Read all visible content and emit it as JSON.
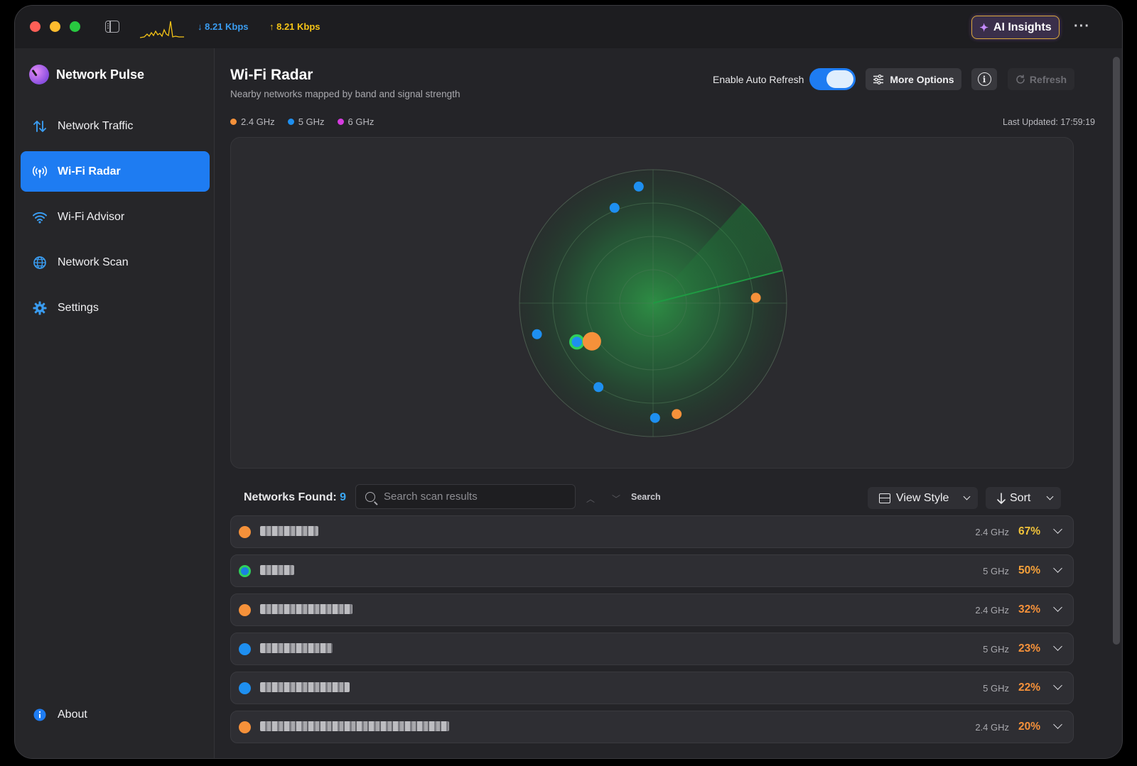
{
  "titlebar": {
    "download_speed": "↓ 8.21 Kbps",
    "upload_speed": "↑ 8.21 Kbps",
    "ai_insights_label": "AI Insights",
    "more_icon": "ellipsis-icon"
  },
  "sidebar": {
    "app_name": "Network Pulse",
    "items": [
      {
        "label": "Network Traffic",
        "icon": "arrows-updown-icon",
        "active": false
      },
      {
        "label": "Wi-Fi Radar",
        "icon": "antenna-icon",
        "active": true
      },
      {
        "label": "Wi-Fi Advisor",
        "icon": "wifi-icon",
        "active": false
      },
      {
        "label": "Network Scan",
        "icon": "globe-icon",
        "active": false
      },
      {
        "label": "Settings",
        "icon": "gear-icon",
        "active": false
      }
    ],
    "about_label": "About"
  },
  "header": {
    "title": "Wi-Fi Radar",
    "subtitle": "Nearby networks mapped by band and signal strength",
    "auto_refresh_label": "Enable Auto Refresh",
    "auto_refresh_on": true,
    "more_options_label": "More Options",
    "refresh_label": "Refresh"
  },
  "legend": [
    {
      "label": "2.4 GHz",
      "color": "#f5913a"
    },
    {
      "label": "5 GHz",
      "color": "#1e8ff0"
    },
    {
      "label": "6 GHz",
      "color": "#d63be0"
    }
  ],
  "last_updated": "Last Updated: 17:59:19",
  "list": {
    "found_label": "Networks Found:",
    "found_count": "9",
    "search_placeholder": "Search scan results",
    "search_label": "Search",
    "view_style_label": "View Style",
    "sort_label": "Sort"
  },
  "networks": [
    {
      "band": "2.4 GHz",
      "signal": "67%",
      "color": "#f5913a",
      "pct_color": "#f0c23a",
      "current": false
    },
    {
      "band": "5 GHz",
      "signal": "50%",
      "color": "#1e8ff0",
      "pct_color": "#f5a13a",
      "current": true
    },
    {
      "band": "2.4 GHz",
      "signal": "32%",
      "color": "#f5913a",
      "pct_color": "#f5913a",
      "current": false
    },
    {
      "band": "5 GHz",
      "signal": "23%",
      "color": "#1e8ff0",
      "pct_color": "#f5913a",
      "current": false
    },
    {
      "band": "5 GHz",
      "signal": "22%",
      "color": "#1e8ff0",
      "pct_color": "#f5913a",
      "current": false
    },
    {
      "band": "2.4 GHz",
      "signal": "20%",
      "color": "#f5913a",
      "pct_color": "#f5913a",
      "current": false
    }
  ],
  "radar_points": [
    {
      "band": "5 GHz",
      "angle_deg": 97,
      "signal": 0.12
    },
    {
      "band": "5 GHz",
      "angle_deg": 112,
      "signal": 0.23
    },
    {
      "band": "2.4 GHz",
      "angle_deg": 3,
      "signal": 0.23
    },
    {
      "band": "5 GHz",
      "angle_deg": 195,
      "signal": 0.1
    },
    {
      "band": "5 GHz",
      "angle_deg": 207,
      "signal": 0.36,
      "current": true
    },
    {
      "band": "2.4 GHz",
      "angle_deg": 212,
      "signal": 0.46
    },
    {
      "band": "5 GHz",
      "angle_deg": 237,
      "signal": 0.25
    },
    {
      "band": "5 GHz",
      "angle_deg": 271,
      "signal": 0.14
    },
    {
      "band": "2.4 GHz",
      "angle_deg": 282,
      "signal": 0.15
    }
  ]
}
